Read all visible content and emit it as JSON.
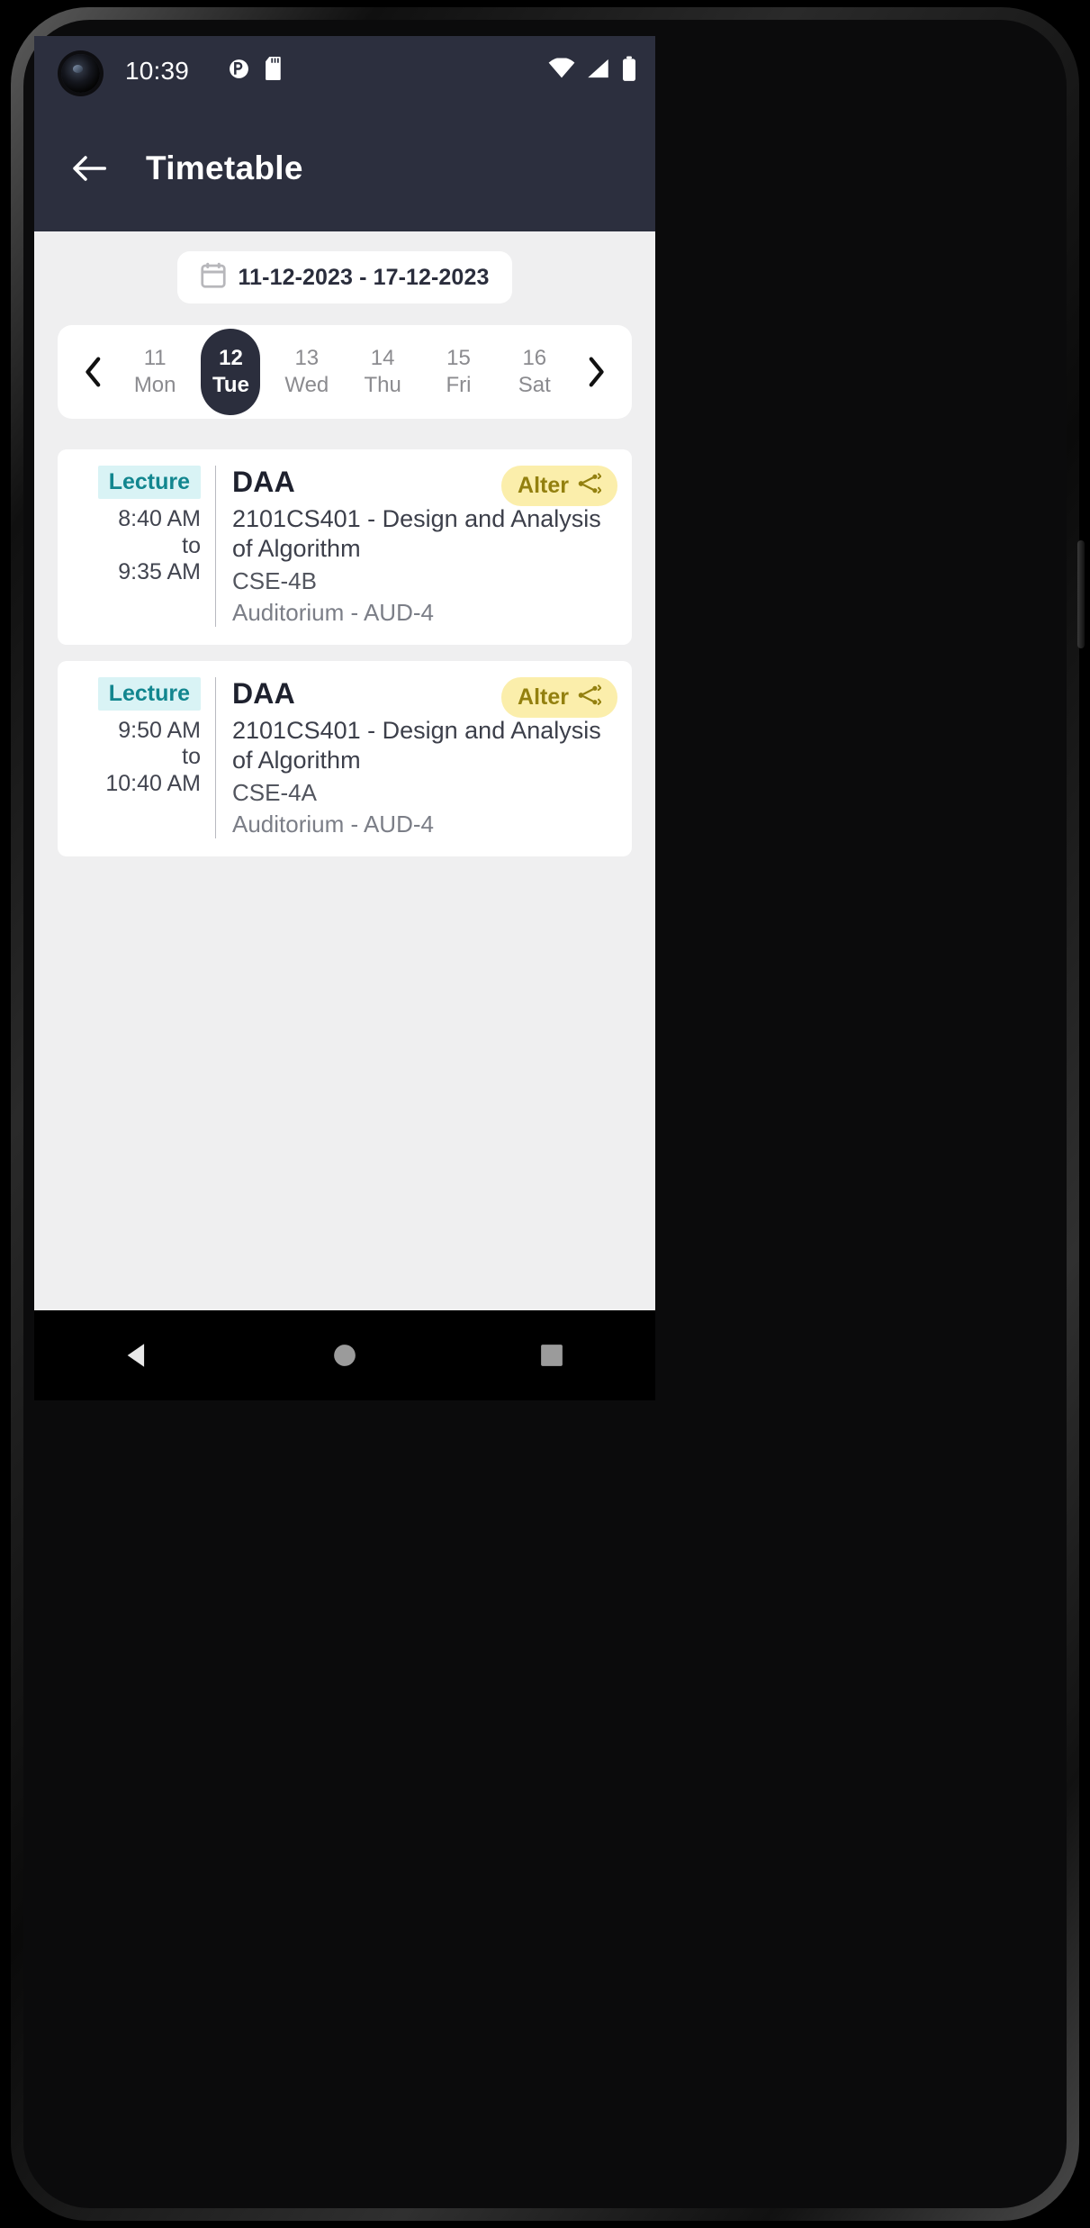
{
  "status_bar": {
    "time": "10:39",
    "left_icons": [
      "do-not-disturb-icon",
      "sd-card-icon"
    ],
    "right_icons": [
      "wifi-icon",
      "cellular-signal-icon",
      "battery-icon"
    ]
  },
  "app_bar": {
    "back_icon": "arrow-left-icon",
    "title": "Timetable"
  },
  "date_range": {
    "icon": "calendar-icon",
    "label": "11-12-2023 - 17-12-2023"
  },
  "day_selector": {
    "prev_icon": "chevron-left-icon",
    "next_icon": "chevron-right-icon",
    "days": [
      {
        "num": "11",
        "name": "Mon",
        "selected": false
      },
      {
        "num": "12",
        "name": "Tue",
        "selected": true
      },
      {
        "num": "13",
        "name": "Wed",
        "selected": false
      },
      {
        "num": "14",
        "name": "Thu",
        "selected": false
      },
      {
        "num": "15",
        "name": "Fri",
        "selected": false
      },
      {
        "num": "16",
        "name": "Sat",
        "selected": false
      }
    ]
  },
  "lectures": [
    {
      "badge": "Lecture",
      "start_time": "8:40 AM",
      "separator": "to",
      "end_time": "9:35 AM",
      "course_code": "DAA",
      "course_name": "2101CS401 - Design and Analysis of Algorithm",
      "batch": "CSE-4B",
      "room": "Auditorium - AUD-4",
      "action_label": "Alter",
      "action_icon": "share-nodes-icon"
    },
    {
      "badge": "Lecture",
      "start_time": "9:50 AM",
      "separator": "to",
      "end_time": "10:40 AM",
      "course_code": "DAA",
      "course_name": "2101CS401 - Design and Analysis of Algorithm",
      "batch": "CSE-4A",
      "room": "Auditorium - AUD-4",
      "action_label": "Alter",
      "action_icon": "share-nodes-icon"
    }
  ],
  "nav_bar": {
    "back_icon": "triangle-back-icon",
    "home_icon": "circle-home-icon",
    "recents_icon": "square-recents-icon"
  },
  "colors": {
    "app_bar": "#2c2f3e",
    "page_bg": "#efeff0",
    "badge_bg": "#d9f3f5",
    "badge_text": "#12868f",
    "alter_bg": "#fbeeab",
    "alter_text": "#93800f",
    "selected_day_bg": "#2b2e3d"
  }
}
